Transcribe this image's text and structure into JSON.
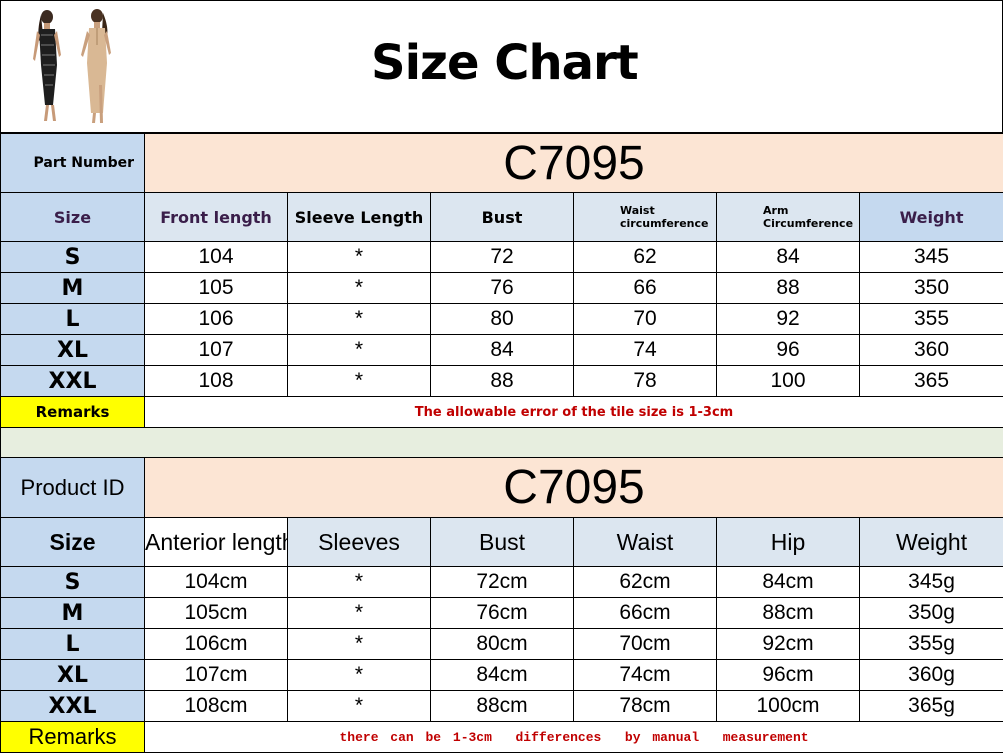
{
  "header": {
    "title": "Size Chart"
  },
  "table1": {
    "part_number_label": "Part Number",
    "code": "C7095",
    "columns": [
      "Size",
      "Front length",
      "Sleeve Length",
      "Bust",
      "Waist\ncircumference",
      "Arm\nCircumference",
      "Weight"
    ],
    "rows": [
      [
        "S",
        "104",
        "*",
        "72",
        "62",
        "84",
        "345"
      ],
      [
        "M",
        "105",
        "*",
        "76",
        "66",
        "88",
        "350"
      ],
      [
        "L",
        "106",
        "*",
        "80",
        "70",
        "92",
        "355"
      ],
      [
        "XL",
        "107",
        "*",
        "84",
        "74",
        "96",
        "360"
      ],
      [
        "XXL",
        "108",
        "*",
        "88",
        "78",
        "100",
        "365"
      ]
    ],
    "remarks_label": "Remarks",
    "remarks_text": "The allowable error of the tile size is 1-3cm"
  },
  "table2": {
    "product_id_label": "Product ID",
    "code": "C7095",
    "columns": [
      "Size",
      "Anterior length",
      "Sleeves",
      "Bust",
      "Waist",
      "Hip",
      "Weight"
    ],
    "rows": [
      [
        "S",
        "104cm",
        "*",
        "72cm",
        "62cm",
        "84cm",
        "345g"
      ],
      [
        "M",
        "105cm",
        "*",
        "76cm",
        "66cm",
        "88cm",
        "350g"
      ],
      [
        "L",
        "106cm",
        "*",
        "80cm",
        "70cm",
        "92cm",
        "355g"
      ],
      [
        "XL",
        "107cm",
        "*",
        "84cm",
        "74cm",
        "96cm",
        "360g"
      ],
      [
        "XXL",
        "108cm",
        "*",
        "88cm",
        "78cm",
        "100cm",
        "365g"
      ]
    ],
    "remarks_label": "Remarks",
    "remarks_text": "there can be 1-3cm  differences  by manual  measurement"
  },
  "colors": {
    "header_blue": "#c5d9ef",
    "code_peach": "#fce5d4",
    "remarks_yellow": "#ffff00",
    "note_red": "#c00000"
  }
}
